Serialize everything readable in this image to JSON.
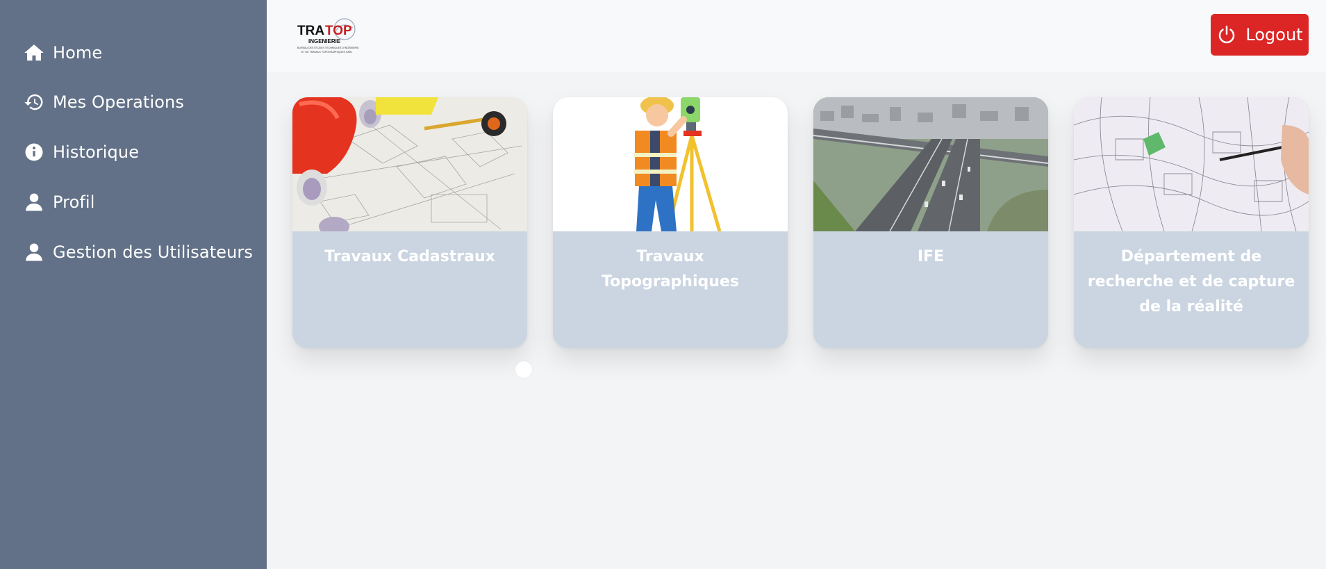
{
  "sidebar": {
    "items": [
      {
        "label": "Home",
        "icon": "home-icon"
      },
      {
        "label": "Mes Operations",
        "icon": "history-icon"
      },
      {
        "label": "Historique",
        "icon": "info-icon"
      },
      {
        "label": "Profil",
        "icon": "user-icon"
      },
      {
        "label": "Gestion des Utilisateurs",
        "icon": "user-icon"
      }
    ]
  },
  "header": {
    "logo": {
      "word_left": "TRA",
      "word_right": "TOP",
      "word_sub": "INGENIERIE",
      "tagline_1": "BUREAU DES ÉTUDES TECHNIQUES D'INGÉNIERIE",
      "tagline_2": "ET DE TRAVAUX TOPOGRAPHIQUES SARL"
    },
    "logout_label": "Logout"
  },
  "cards": [
    {
      "title": "Travaux Cadastraux"
    },
    {
      "title": "Travaux Topographiques"
    },
    {
      "title": "IFE"
    },
    {
      "title": "Département de recherche et de capture de la réalité"
    }
  ],
  "colors": {
    "sidebar": "#627187",
    "card": "#cbd5e1",
    "logout": "#dc2626",
    "background": "#f3f4f6"
  }
}
